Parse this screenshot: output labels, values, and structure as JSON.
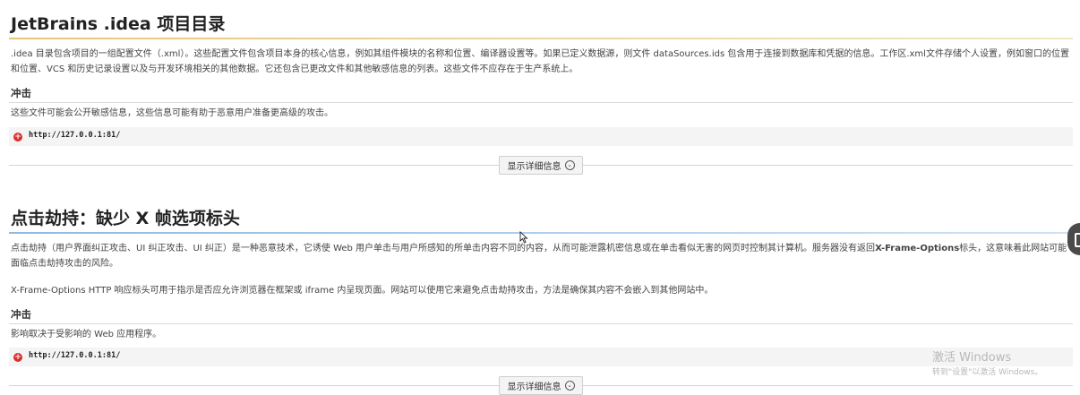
{
  "section1": {
    "title": "JetBrains .idea 项目目录",
    "description": ".idea 目录包含项目的一组配置文件（.xml）。这些配置文件包含项目本身的核心信息，例如其组件模块的名称和位置、编译器设置等。如果已定义数据源，则文件 dataSources.ids 包含用于连接到数据库和凭据的信息。工作区.xml文件存储个人设置，例如窗口的位置和位置、VCS 和历史记录设置以及与开发环境相关的其他数据。它还包含已更改文件和其他敏感信息的列表。这些文件不应存在于生产系统上。",
    "impact_heading": "冲击",
    "impact_text": "这些文件可能会公开敏感信息，这些信息可能有助于恶意用户准备更高级的攻击。",
    "url": "http://127.0.0.1:81/",
    "details_button": "显示详细信息"
  },
  "section2": {
    "title": "点击劫持：缺少 X 帧选项标头",
    "description": "点击劫持（用户界面纠正攻击、UI 纠正攻击、UI 纠正）是一种恶意技术，它诱使 Web 用户单击与用户所感知的所单击内容不同的内容，从而可能泄露机密信息或在单击看似无害的网页时控制其计算机。服务器没有返回",
    "description_bold": "X-Frame-Options",
    "description_tail": "标头，这意味着此网站可能面临点击劫持攻击的风险。",
    "description2": "X-Frame-Options HTTP 响应标头可用于指示是否应允许浏览器在框架或 iframe 内呈现页面。网站可以使用它来避免点击劫持攻击，方法是确保其内容不会嵌入到其他网站中。",
    "impact_heading": "冲击",
    "impact_text": "影响取决于受影响的 Web 应用程序。",
    "url": "http://127.0.0.1:81/",
    "details_button": "显示详细信息"
  },
  "watermark": {
    "line1": "激活 Windows",
    "line2": "转到\"设置\"以激活 Windows。"
  },
  "colors": {
    "section1_rule": "#e8d49a",
    "section2_rule": "#9cc3e6",
    "alert_dot": "#d9302c"
  },
  "icons": {
    "alert": "alert-circle-icon",
    "chevron": "chevron-down-circle-icon"
  }
}
